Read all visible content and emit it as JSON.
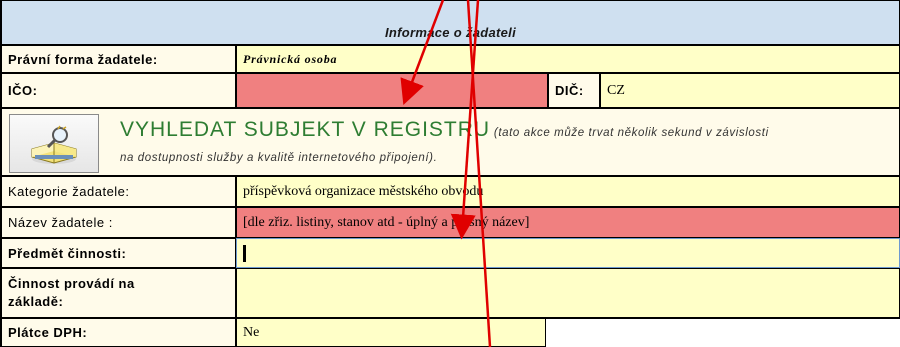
{
  "form": {
    "header": "Informace o žadateli",
    "pravni_forma": {
      "label": "Právní forma žadatele:",
      "value": "Právnická osoba"
    },
    "ico": {
      "label": "IČO:",
      "value": ""
    },
    "dic": {
      "label": "DIČ:",
      "value": "CZ"
    },
    "search": {
      "title": "VYHLEDAT SUBJEKT V REGISTRU",
      "note_line1": " (tato akce může trvat několik sekund v závislosti",
      "note_line2": "na dostupnosti služby a kvalitě internetového připojení)."
    },
    "kategorie": {
      "label": "Kategorie žadatele:",
      "value": "příspěvková organizace městského obvodu"
    },
    "nazev": {
      "label": "Název žadatele :",
      "value": "[dle zřiz. listiny, stanov atd - úplný a přesný název]"
    },
    "predmet": {
      "label": "Předmět činnosti:",
      "value": ""
    },
    "cinnost": {
      "label_line1": "Činnost provádí na",
      "label_line2": "základě:",
      "value": ""
    },
    "dph": {
      "label": "Plátce DPH:",
      "value": "Ne"
    }
  },
  "icons": {
    "search_button": "book-with-magnifier-icon",
    "arrow": "red-annotation-arrow-icon"
  },
  "colors": {
    "header_bg": "#cfe0f0",
    "label_bg": "#fffbea",
    "input_yellow": "#ffffc8",
    "required_red": "#f08080",
    "link_green": "#2e7d32",
    "arrow_red": "#e00000"
  }
}
